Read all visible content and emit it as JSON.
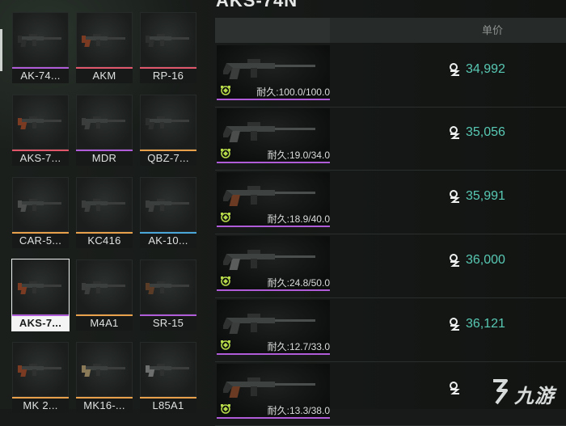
{
  "header": {
    "title": "AKS-74N"
  },
  "list_header": {
    "price_label": "单价"
  },
  "grid": [
    {
      "name": "AK-74...",
      "rarity_color": "#b05cd8"
    },
    {
      "name": "AKM",
      "rarity_color": "#e0566a"
    },
    {
      "name": "RP-16",
      "rarity_color": "#e0566a"
    },
    {
      "name": "AKS-7...",
      "rarity_color": "#e0566a"
    },
    {
      "name": "MDR",
      "rarity_color": "#b05cd8"
    },
    {
      "name": "QBZ-7...",
      "rarity_color": "#e8a04a"
    },
    {
      "name": "CAR-5...",
      "rarity_color": "#e8a04a"
    },
    {
      "name": "KC416",
      "rarity_color": "#e8a04a"
    },
    {
      "name": "AK-10...",
      "rarity_color": "#4aa6d8"
    },
    {
      "name": "AKS-7...",
      "rarity_color": "#b05cd8",
      "selected": true
    },
    {
      "name": "M4A1",
      "rarity_color": "#e8a04a"
    },
    {
      "name": "SR-15",
      "rarity_color": "#b05cd8"
    },
    {
      "name": "MK 2...",
      "rarity_color": "#e8a04a"
    },
    {
      "name": "MK16-...",
      "rarity_color": "#e8a04a"
    },
    {
      "name": "L85A1",
      "rarity_color": "#e8a04a"
    }
  ],
  "listings": [
    {
      "durability": "耐久:100.0/100.0",
      "price": "34,992"
    },
    {
      "durability": "耐久:19.0/34.0",
      "price": "35,056"
    },
    {
      "durability": "耐久:18.9/40.0",
      "price": "35,991"
    },
    {
      "durability": "耐久:24.8/50.0",
      "price": "36,000"
    },
    {
      "durability": "耐久:12.7/33.0",
      "price": "36,121"
    },
    {
      "durability": "耐久:13.3/38.0",
      "price": ""
    }
  ],
  "colors": {
    "price": "#58c9b4",
    "rarity_purple": "#b05cd8",
    "durability_icon": "#b6d94a"
  },
  "watermark": {
    "text": "九游"
  }
}
